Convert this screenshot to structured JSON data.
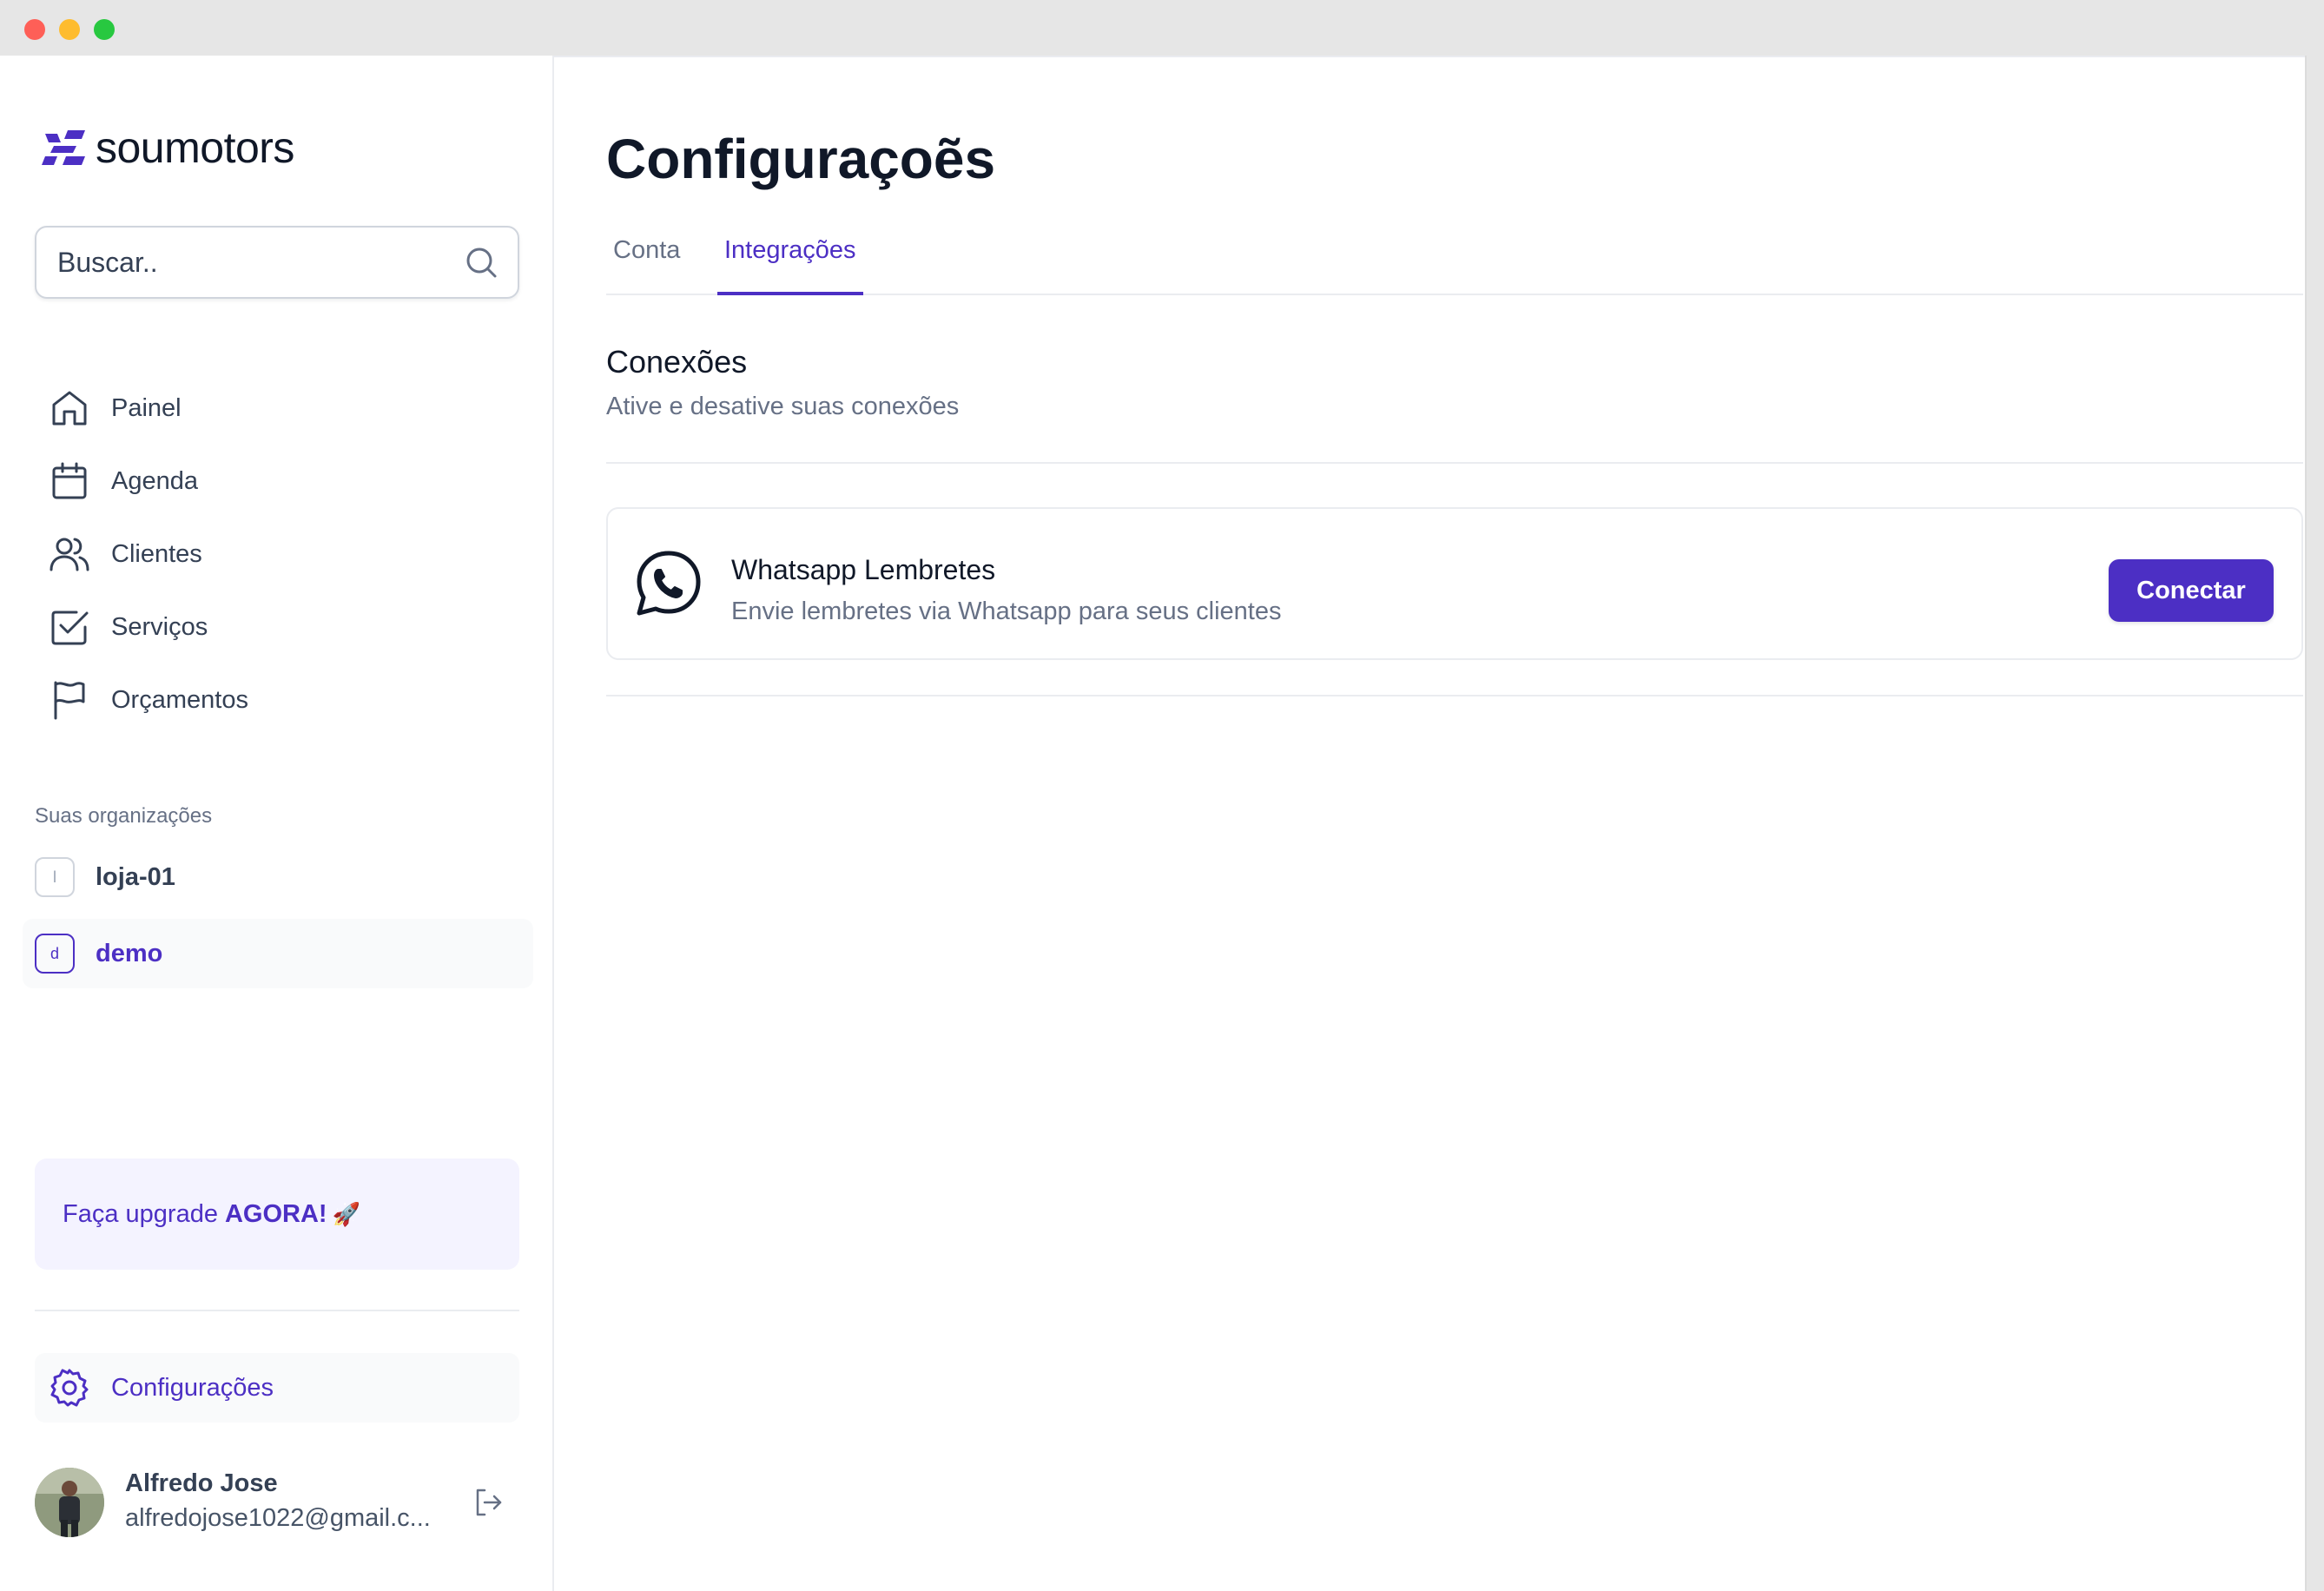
{
  "app": {
    "brand": "soumotors",
    "accent": "#4c2fc4"
  },
  "search": {
    "placeholder": "Buscar.."
  },
  "nav": [
    {
      "label": "Painel",
      "icon": "home-icon"
    },
    {
      "label": "Agenda",
      "icon": "calendar-icon"
    },
    {
      "label": "Clientes",
      "icon": "users-icon"
    },
    {
      "label": "Serviços",
      "icon": "check-square-icon"
    },
    {
      "label": "Orçamentos",
      "icon": "flag-icon"
    }
  ],
  "orgs": {
    "title": "Suas organizações",
    "items": [
      {
        "initial": "l",
        "name": "loja-01",
        "active": false
      },
      {
        "initial": "d",
        "name": "demo",
        "active": true
      }
    ]
  },
  "upgrade": {
    "prefix": "Faça upgrade",
    "emphasis": "AGORA!",
    "emoji": "🚀"
  },
  "settings": {
    "label": "Configurações",
    "icon": "gear-icon"
  },
  "user": {
    "name": "Alfredo Jose",
    "email": "alfredojose1022@gmail.c..."
  },
  "main": {
    "title": "Configuraçoẽs",
    "tabs": [
      {
        "label": "Conta",
        "active": false
      },
      {
        "label": "Integrações",
        "active": true
      }
    ],
    "section": {
      "title": "Conexões",
      "subtitle": "Ative e desative suas conexões"
    },
    "integration": {
      "icon": "whatsapp-icon",
      "title": "Whatsapp Lembretes",
      "subtitle": "Envie lembretes via Whatsapp para seus clientes",
      "button": "Conectar"
    }
  }
}
